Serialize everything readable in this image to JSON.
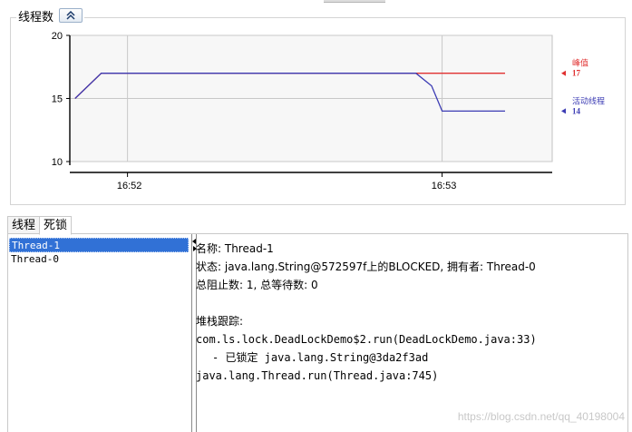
{
  "threads_panel": {
    "title": "线程数",
    "collapse_icon": "double-chevron-up-icon"
  },
  "chart_data": {
    "type": "line",
    "title": "",
    "xlabel": "",
    "ylabel": "",
    "ylim": [
      10,
      20
    ],
    "yticks": [
      "20",
      "15",
      "10"
    ],
    "xticks": [
      "16:52",
      "16:53"
    ],
    "grid": true,
    "legend_position": "right",
    "series": [
      {
        "name": "峰值",
        "color": "#e03030",
        "current": "17",
        "x": [
          "16:51:50",
          "16:51:55",
          "16:52:55",
          "16:53:12"
        ],
        "values": [
          15,
          17,
          17,
          17
        ]
      },
      {
        "name": "活动线程",
        "color": "#3c3cb4",
        "current": "14",
        "x": [
          "16:51:50",
          "16:51:55",
          "16:52:55",
          "16:52:58",
          "16:53:00",
          "16:53:12"
        ],
        "values": [
          15,
          17,
          17,
          16,
          14,
          14
        ]
      }
    ]
  },
  "tabs": [
    {
      "label": "线程"
    },
    {
      "label": "死锁"
    }
  ],
  "thread_list": [
    "Thread-1",
    "Thread-0"
  ],
  "details": {
    "name_line": "名称: Thread-1",
    "state_line": "状态: java.lang.String@572597f上的BLOCKED, 拥有者: Thread-0",
    "counts_line": "总阻止数: 1, 总等待数: 0",
    "stack_title": "堆栈跟踪:",
    "stack": [
      "com.ls.lock.DeadLockDemo$2.run(DeadLockDemo.java:33)",
      "- 已锁定 java.lang.String@3da2f3ad",
      "java.lang.Thread.run(Thread.java:745)"
    ]
  },
  "watermark": "https://blog.csdn.net/qq_40198004"
}
